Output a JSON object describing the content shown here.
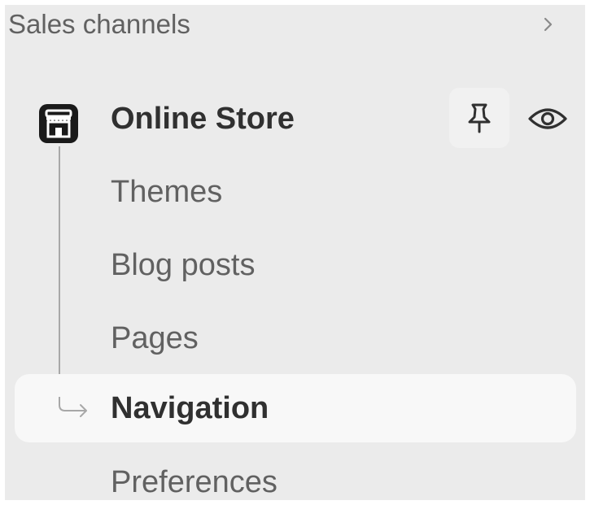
{
  "sidebar": {
    "section_title": "Sales channels",
    "section_expand_icon": "chevron-right-icon",
    "channel": {
      "label": "Online Store",
      "icon": "store-icon",
      "pin_icon": "pin-icon",
      "view_icon": "eye-icon"
    },
    "items": [
      {
        "label": "Themes",
        "active": false
      },
      {
        "label": "Blog posts",
        "active": false
      },
      {
        "label": "Pages",
        "active": false
      },
      {
        "label": "Navigation",
        "active": true
      },
      {
        "label": "Preferences",
        "active": false
      }
    ]
  },
  "colors": {
    "panel_background": "#ebebeb",
    "active_item_background": "#f8f8f8",
    "text_primary": "#303030",
    "text_secondary": "#616161"
  }
}
